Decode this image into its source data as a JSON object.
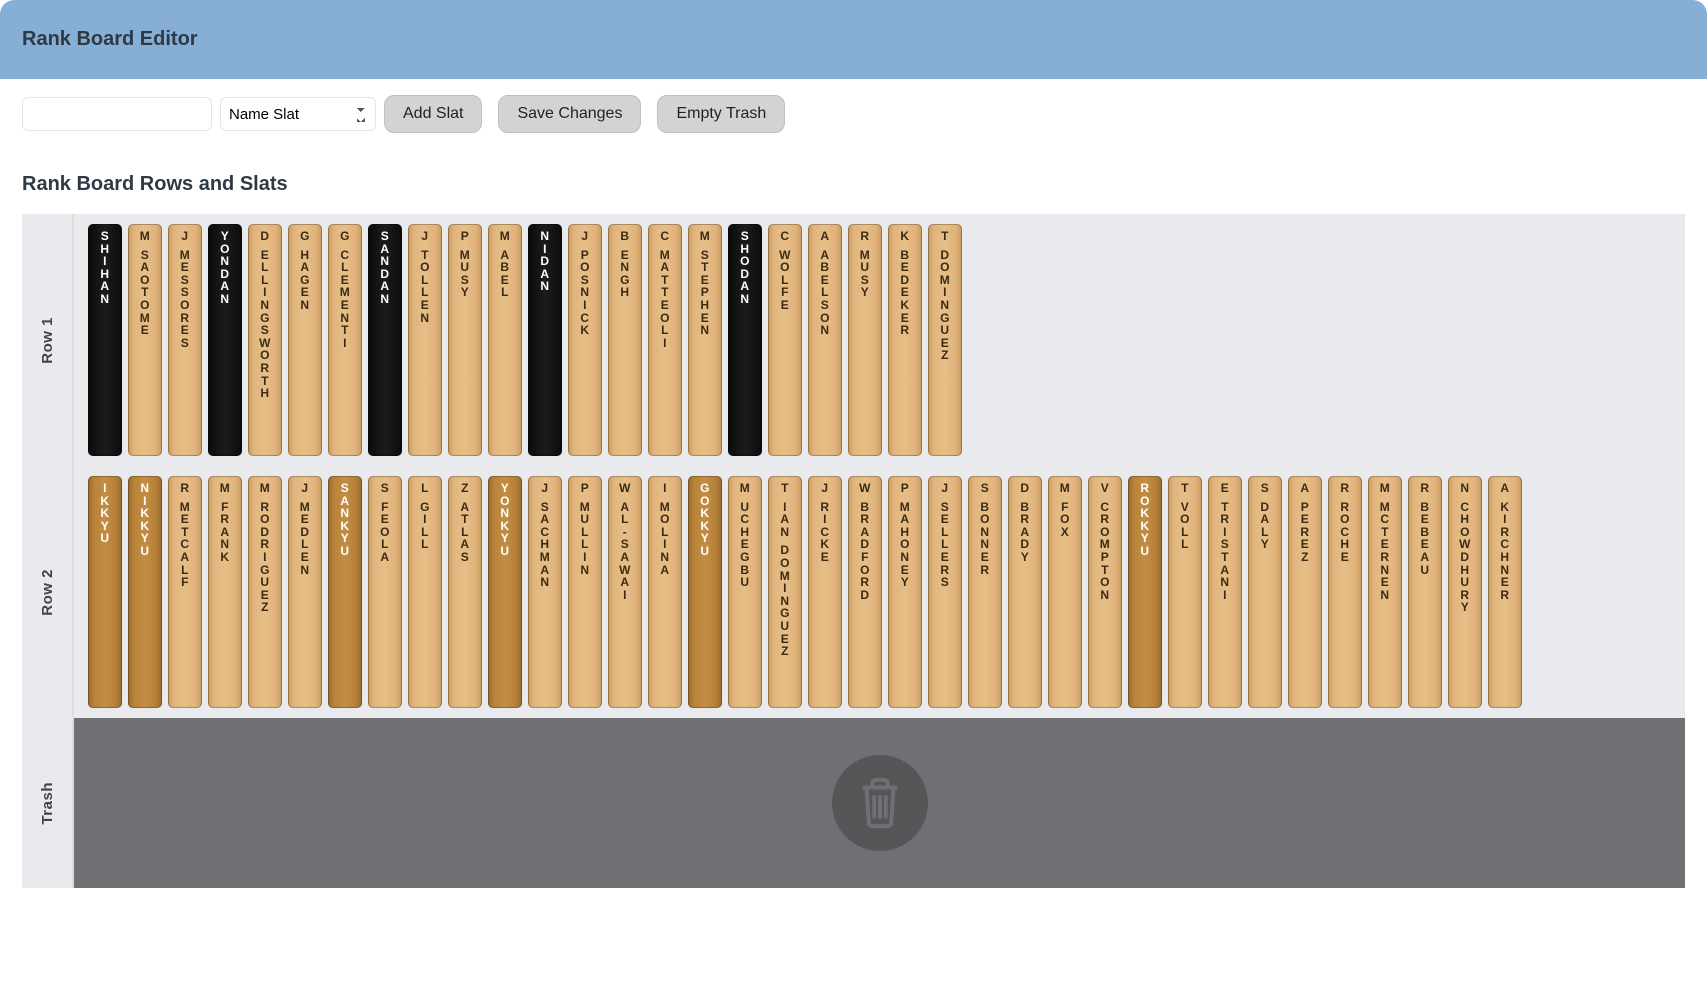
{
  "header": {
    "title": "Rank Board Editor"
  },
  "toolbar": {
    "name_input_value": "",
    "name_input_placeholder": "",
    "select_value": "Name Slat",
    "add_slat_label": "Add Slat",
    "save_changes_label": "Save Changes",
    "empty_trash_label": "Empty Trash"
  },
  "board": {
    "title": "Rank Board Rows and Slats",
    "rows": [
      {
        "label": "Row 1",
        "slats": [
          {
            "style": "black",
            "kind": "rank",
            "text": "SHIHAN"
          },
          {
            "style": "light",
            "kind": "name",
            "initial": "M",
            "surname": "SAOTOME"
          },
          {
            "style": "light",
            "kind": "name",
            "initial": "J",
            "surname": "MESSORES"
          },
          {
            "style": "black",
            "kind": "rank",
            "text": "YONDAN"
          },
          {
            "style": "light",
            "kind": "name",
            "initial": "D",
            "surname": "ELLINGSWORTH"
          },
          {
            "style": "light",
            "kind": "name",
            "initial": "G",
            "surname": "HAGEN"
          },
          {
            "style": "light",
            "kind": "name",
            "initial": "G",
            "surname": "CLEMENTI"
          },
          {
            "style": "black",
            "kind": "rank",
            "text": "SANDAN"
          },
          {
            "style": "light",
            "kind": "name",
            "initial": "J",
            "surname": "TOLLEN"
          },
          {
            "style": "light",
            "kind": "name",
            "initial": "P",
            "surname": "MUSY"
          },
          {
            "style": "light",
            "kind": "name",
            "initial": "M",
            "surname": "ABEL"
          },
          {
            "style": "black",
            "kind": "rank",
            "text": "NIDAN"
          },
          {
            "style": "light",
            "kind": "name",
            "initial": "J",
            "surname": "POSNICK"
          },
          {
            "style": "light",
            "kind": "name",
            "initial": "B",
            "surname": "ENGH"
          },
          {
            "style": "light",
            "kind": "name",
            "initial": "C",
            "surname": "MATTEOLI"
          },
          {
            "style": "light",
            "kind": "name",
            "initial": "M",
            "surname": "STEPHEN"
          },
          {
            "style": "black",
            "kind": "rank",
            "text": "SHODAN"
          },
          {
            "style": "light",
            "kind": "name",
            "initial": "C",
            "surname": "WOLFE"
          },
          {
            "style": "light",
            "kind": "name",
            "initial": "A",
            "surname": "ABELSON"
          },
          {
            "style": "light",
            "kind": "name",
            "initial": "R",
            "surname": "MUSY"
          },
          {
            "style": "light",
            "kind": "name",
            "initial": "K",
            "surname": "BEDEKER"
          },
          {
            "style": "light",
            "kind": "name",
            "initial": "T",
            "surname": "DOMINGUEZ"
          }
        ]
      },
      {
        "label": "Row 2",
        "slats": [
          {
            "style": "rankb",
            "kind": "rank",
            "text": "IKKYU"
          },
          {
            "style": "rankb",
            "kind": "rank",
            "text": "NIKKYU"
          },
          {
            "style": "light",
            "kind": "name",
            "initial": "R",
            "surname": "METCALF"
          },
          {
            "style": "light",
            "kind": "name",
            "initial": "M",
            "surname": "FRANK"
          },
          {
            "style": "light",
            "kind": "name",
            "initial": "M",
            "surname": "RODRIGUEZ"
          },
          {
            "style": "light",
            "kind": "name",
            "initial": "J",
            "surname": "MEDLEN"
          },
          {
            "style": "rankb",
            "kind": "rank",
            "text": "SANKYU"
          },
          {
            "style": "light",
            "kind": "name",
            "initial": "S",
            "surname": "FEOLA"
          },
          {
            "style": "light",
            "kind": "name",
            "initial": "L",
            "surname": "GILL"
          },
          {
            "style": "light",
            "kind": "name",
            "initial": "Z",
            "surname": "ATLAS"
          },
          {
            "style": "rankb",
            "kind": "rank",
            "text": "YONKYU"
          },
          {
            "style": "light",
            "kind": "name",
            "initial": "J",
            "surname": "SACHMAN"
          },
          {
            "style": "light",
            "kind": "name",
            "initial": "P",
            "surname": "MULLIN"
          },
          {
            "style": "light",
            "kind": "name",
            "initial": "W",
            "surname": "AL-SAWAI"
          },
          {
            "style": "light",
            "kind": "name",
            "initial": "I",
            "surname": "MOLINA"
          },
          {
            "style": "rankb",
            "kind": "rank",
            "text": "GOKKYU"
          },
          {
            "style": "light",
            "kind": "name",
            "initial": "M",
            "surname": "UCHEGBU"
          },
          {
            "style": "light",
            "kind": "name",
            "initial": "T",
            "surname": "IAN DOMINGUEZ"
          },
          {
            "style": "light",
            "kind": "name",
            "initial": "J",
            "surname": "RICKE"
          },
          {
            "style": "light",
            "kind": "name",
            "initial": "W",
            "surname": "BRADFORD"
          },
          {
            "style": "light",
            "kind": "name",
            "initial": "P",
            "surname": "MAHONEY"
          },
          {
            "style": "light",
            "kind": "name",
            "initial": "J",
            "surname": "SELLERS"
          },
          {
            "style": "light",
            "kind": "name",
            "initial": "S",
            "surname": "BONNER"
          },
          {
            "style": "light",
            "kind": "name",
            "initial": "D",
            "surname": "BRADY"
          },
          {
            "style": "light",
            "kind": "name",
            "initial": "M",
            "surname": "FOX"
          },
          {
            "style": "light",
            "kind": "name",
            "initial": "V",
            "surname": "CROMPTON"
          },
          {
            "style": "rankb",
            "kind": "rank",
            "text": "ROKKYU"
          },
          {
            "style": "light",
            "kind": "name",
            "initial": "T",
            "surname": "VOLL"
          },
          {
            "style": "light",
            "kind": "name",
            "initial": "E",
            "surname": "TRISTANI"
          },
          {
            "style": "light",
            "kind": "name",
            "initial": "S",
            "surname": "DALY"
          },
          {
            "style": "light",
            "kind": "name",
            "initial": "A",
            "surname": "PEREZ"
          },
          {
            "style": "light",
            "kind": "name",
            "initial": "R",
            "surname": "ROCHE"
          },
          {
            "style": "light",
            "kind": "name",
            "initial": "M",
            "surname": "MCTERNEN"
          },
          {
            "style": "light",
            "kind": "name",
            "initial": "R",
            "surname": "BEBEAU"
          },
          {
            "style": "light",
            "kind": "name",
            "initial": "N",
            "surname": "CHOWDHURY"
          },
          {
            "style": "light",
            "kind": "name",
            "initial": "A",
            "surname": "KIRCHNER"
          }
        ]
      }
    ],
    "trash": {
      "label": "Trash"
    }
  }
}
